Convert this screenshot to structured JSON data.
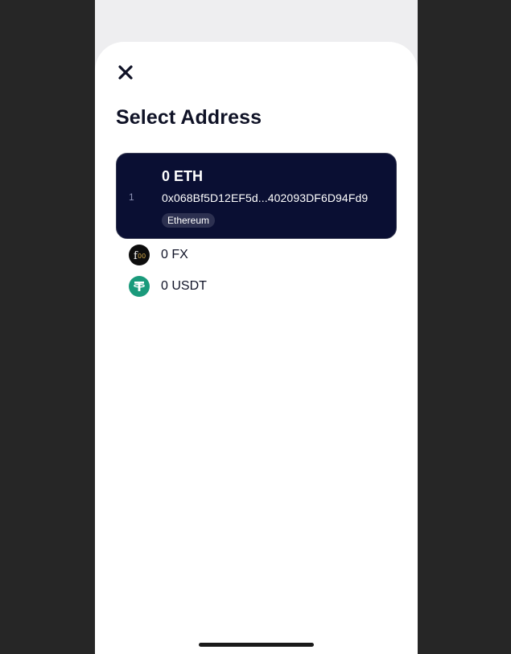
{
  "sheet": {
    "title": "Select Address",
    "close_icon": "close-icon"
  },
  "addresses": [
    {
      "index": "1",
      "amount": "0 ETH",
      "address": "0x068Bf5D12EF5d...402093DF6D94Fd9",
      "network": "Ethereum",
      "selected": true
    }
  ],
  "tokens": [
    {
      "label": "0 FX",
      "icon": "fx-token-icon"
    },
    {
      "label": "0 USDT",
      "icon": "usdt-token-icon"
    }
  ],
  "colors": {
    "selected_card_bg": "#0a0f33",
    "title_text": "#0f1226",
    "usdt_green": "#1a9a7b",
    "fx_black": "#0d0d0d"
  }
}
